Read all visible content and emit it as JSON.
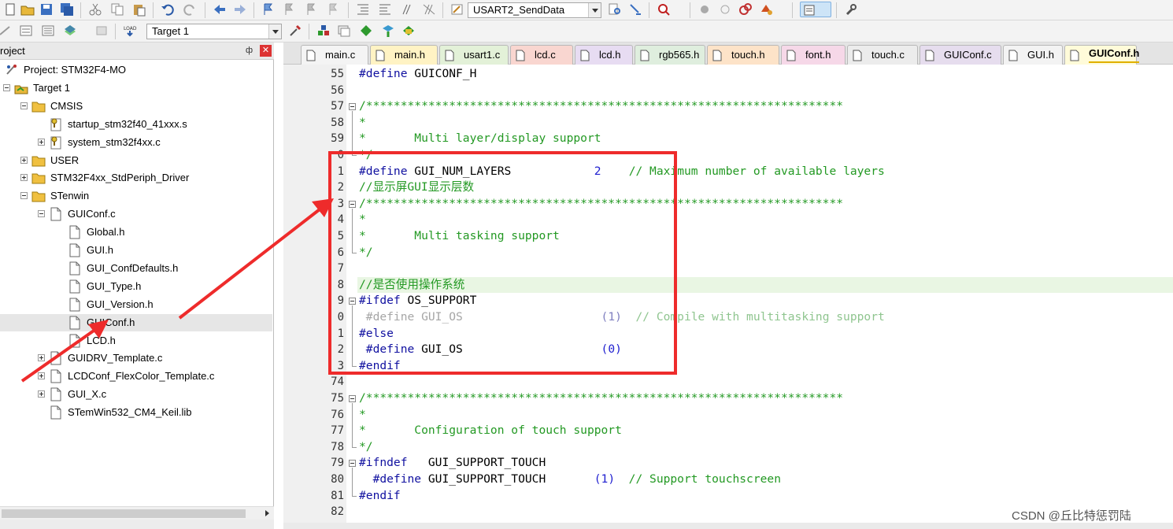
{
  "toolbar": {
    "function_combo": "USART2_SendData",
    "target_combo": "Target 1"
  },
  "panel": {
    "title": "roject",
    "pin": "ф",
    "close": "✕"
  },
  "tree": [
    {
      "label": "Project: STM32F4-MO",
      "icon": "project-icon",
      "indent": 0
    },
    {
      "label": "Target 1",
      "icon": "target-icon",
      "indent": 1
    },
    {
      "label": "CMSIS",
      "icon": "folder-icon",
      "indent": 2
    },
    {
      "label": "startup_stm32f40_41xxx.s",
      "icon": "key-file-icon",
      "indent": 3
    },
    {
      "label": "system_stm32f4xx.c",
      "icon": "key-file-icon",
      "indent": 3
    },
    {
      "label": "USER",
      "icon": "folder-icon",
      "indent": 2
    },
    {
      "label": "STM32F4xx_StdPeriph_Driver",
      "icon": "folder-icon",
      "indent": 2
    },
    {
      "label": "STenwin",
      "icon": "folder-icon",
      "indent": 2
    },
    {
      "label": "GUIConf.c",
      "icon": "file-icon",
      "indent": 3
    },
    {
      "label": "Global.h",
      "icon": "file-icon",
      "indent": 4
    },
    {
      "label": "GUI.h",
      "icon": "file-icon",
      "indent": 4
    },
    {
      "label": "GUI_ConfDefaults.h",
      "icon": "file-icon",
      "indent": 4
    },
    {
      "label": "GUI_Type.h",
      "icon": "file-icon",
      "indent": 4
    },
    {
      "label": "GUI_Version.h",
      "icon": "file-icon",
      "indent": 4
    },
    {
      "label": "GUIConf.h",
      "icon": "file-icon",
      "indent": 4
    },
    {
      "label": "LCD.h",
      "icon": "file-icon",
      "indent": 4
    },
    {
      "label": "GUIDRV_Template.c",
      "icon": "file-icon",
      "indent": 3
    },
    {
      "label": "LCDConf_FlexColor_Template.c",
      "icon": "file-icon",
      "indent": 3
    },
    {
      "label": "GUI_X.c",
      "icon": "file-icon",
      "indent": 3
    },
    {
      "label": "STemWin532_CM4_Keil.lib",
      "icon": "file-icon",
      "indent": 3
    }
  ],
  "tabs": [
    {
      "label": "main.c",
      "color": "#f4f4f4"
    },
    {
      "label": "main.h",
      "color": "#fff3c4"
    },
    {
      "label": "usart1.c",
      "color": "#e3f1d8"
    },
    {
      "label": "lcd.c",
      "color": "#f9d6d0"
    },
    {
      "label": "lcd.h",
      "color": "#e7dcf2"
    },
    {
      "label": "rgb565.h",
      "color": "#dfeede"
    },
    {
      "label": "touch.h",
      "color": "#fde3c8"
    },
    {
      "label": "font.h",
      "color": "#f6d8e8"
    },
    {
      "label": "touch.c",
      "color": "#ececec"
    },
    {
      "label": "GUIConf.c",
      "color": "#e6ddee"
    },
    {
      "label": "GUI.h",
      "color": "#f3f3f3"
    },
    {
      "label": "GUIConf.h",
      "color": "#fffbd9"
    }
  ],
  "code": {
    "line_numbers": [
      "55",
      "56",
      "57",
      "58",
      "59",
      "0",
      "1",
      "2",
      "3",
      "4",
      "5",
      "6",
      "7",
      "8",
      "9",
      "0",
      "1",
      "2",
      "3",
      "74",
      "75",
      "76",
      "77",
      "78",
      "79",
      "80",
      "81",
      "82"
    ],
    "lines": [
      [
        {
          "t": "#define ",
          "c": "pp"
        },
        {
          "t": "GUICONF_H",
          "c": "mac"
        }
      ],
      [],
      [
        {
          "t": "/*********************************************************************",
          "c": "cmt"
        }
      ],
      [
        {
          "t": "*",
          "c": "cmt"
        }
      ],
      [
        {
          "t": "*       Multi layer/display support",
          "c": "cmt"
        }
      ],
      [
        {
          "t": "*/",
          "c": "cmt"
        }
      ],
      [
        {
          "t": "#define ",
          "c": "pp"
        },
        {
          "t": "GUI_NUM_LAYERS            ",
          "c": "mac"
        },
        {
          "t": "2",
          "c": "num"
        },
        {
          "t": "    // Maximum number of available layers",
          "c": "cmt"
        }
      ],
      [
        {
          "t": "//显示屏GUI显示层数",
          "c": "cmt"
        }
      ],
      [
        {
          "t": "/*********************************************************************",
          "c": "cmt"
        }
      ],
      [
        {
          "t": "*",
          "c": "cmt"
        }
      ],
      [
        {
          "t": "*       Multi tasking support",
          "c": "cmt"
        }
      ],
      [
        {
          "t": "*/",
          "c": "cmt"
        }
      ],
      [],
      [
        {
          "t": "//是否使用操作系统",
          "c": "cmt"
        }
      ],
      [
        {
          "t": "#ifdef ",
          "c": "pp"
        },
        {
          "t": "OS_SUPPORT",
          "c": "mac"
        }
      ],
      [
        {
          "t": " #define GUI_OS                    ",
          "c": "ppdim"
        },
        {
          "t": "(1)",
          "c": "numdim"
        },
        {
          "t": "  // Compile with multitasking support",
          "c": "cmtdim"
        }
      ],
      [
        {
          "t": "#else",
          "c": "pp"
        }
      ],
      [
        {
          "t": " #define ",
          "c": "pp"
        },
        {
          "t": "GUI_OS                    ",
          "c": "mac"
        },
        {
          "t": "(0)",
          "c": "num"
        }
      ],
      [
        {
          "t": "#endif",
          "c": "pp"
        }
      ],
      [],
      [
        {
          "t": "/*********************************************************************",
          "c": "cmt"
        }
      ],
      [
        {
          "t": "*",
          "c": "cmt"
        }
      ],
      [
        {
          "t": "*       Configuration of touch support",
          "c": "cmt"
        }
      ],
      [
        {
          "t": "*/",
          "c": "cmt"
        }
      ],
      [
        {
          "t": "#ifndef   ",
          "c": "pp"
        },
        {
          "t": "GUI_SUPPORT_TOUCH",
          "c": "mac"
        }
      ],
      [
        {
          "t": "  #define ",
          "c": "pp"
        },
        {
          "t": "GUI_SUPPORT_TOUCH       ",
          "c": "mac"
        },
        {
          "t": "(1)",
          "c": "num"
        },
        {
          "t": "  // Support touchscreen",
          "c": "cmt"
        }
      ],
      [
        {
          "t": "#endif",
          "c": "pp"
        }
      ],
      []
    ]
  },
  "watermark": "CSDN @丘比特惩罚陆",
  "colors": {
    "annotation": "#ee2b2b",
    "highlight_line": "#e9f6e3"
  }
}
